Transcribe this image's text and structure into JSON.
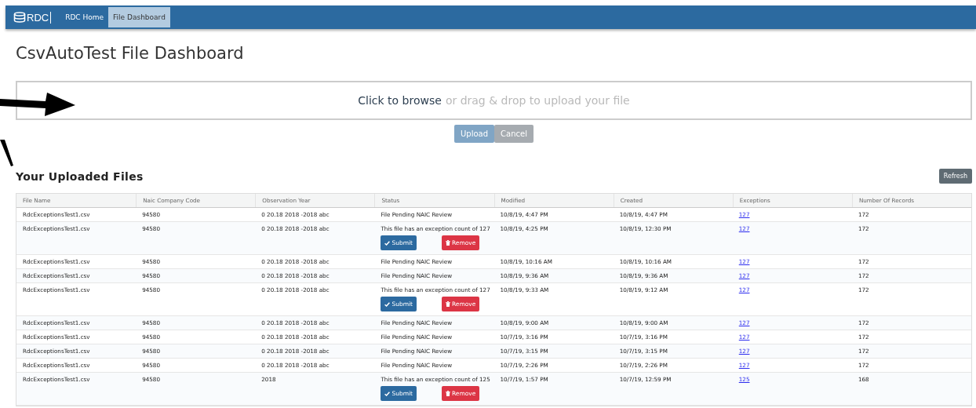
{
  "navbar": {
    "logo": "RDC",
    "items": [
      {
        "label": "RDC Home",
        "selected": false
      },
      {
        "label": "File Dashboard",
        "selected": true
      }
    ]
  },
  "page_title": "CsvAutoTest File Dashboard",
  "dropzone": {
    "link": "Click to browse",
    "hint": "or drag & drop to upload your file"
  },
  "upload_buttons": [
    {
      "label": "Upload",
      "kind": "primary",
      "disabled": true
    },
    {
      "label": "Cancel",
      "kind": "secondary",
      "disabled": true
    }
  ],
  "section_title": "Your Uploaded Files",
  "refresh_button": "Refresh",
  "table": {
    "columns": [
      "File Name",
      "Naic Company Code",
      "Observation Year",
      "Status",
      "Modified",
      "Created",
      "Exceptions",
      "Number Of Records"
    ],
    "rows": [
      {
        "file": "RdcExceptionsTest1.csv",
        "naic": "94580",
        "year": "0 20.18 2018 -2018 abc",
        "status": "File Pending NAIC Review",
        "modified": "10/8/19, 4:47 PM",
        "created": "10/8/19, 4:47 PM",
        "exceptions": "127",
        "records": "172"
      },
      {
        "file": "RdcExceptionsTest1.csv",
        "naic": "94580",
        "year": "0 20.18 2018 -2018 abc",
        "status": "This file has an exception count of 127",
        "actions": [
          {
            "label": "Submit",
            "kind": "submit"
          },
          {
            "label": "Remove",
            "kind": "remove"
          }
        ],
        "modified": "10/8/19, 4:25 PM",
        "created": "10/8/19, 12:30 PM",
        "exceptions": "127",
        "records": "172"
      },
      {
        "file": "RdcExceptionsTest1.csv",
        "naic": "94580",
        "year": "0 20.18 2018 -2018 abc",
        "status": "File Pending NAIC Review",
        "modified": "10/8/19, 10:16 AM",
        "created": "10/8/19, 10:16 AM",
        "exceptions": "127",
        "records": "172"
      },
      {
        "file": "RdcExceptionsTest1.csv",
        "naic": "94580",
        "year": "0 20.18 2018 -2018 abc",
        "status": "File Pending NAIC Review",
        "modified": "10/8/19, 9:36 AM",
        "created": "10/8/19, 9:36 AM",
        "exceptions": "127",
        "records": "172"
      },
      {
        "file": "RdcExceptionsTest1.csv",
        "naic": "94580",
        "year": "0 20.18 2018 -2018 abc",
        "status": "This file has an exception count of 127",
        "actions": [
          {
            "label": "Submit",
            "kind": "submit"
          },
          {
            "label": "Remove",
            "kind": "remove"
          }
        ],
        "modified": "10/8/19, 9:33 AM",
        "created": "10/8/19, 9:12 AM",
        "exceptions": "127",
        "records": "172"
      },
      {
        "file": "RdcExceptionsTest1.csv",
        "naic": "94580",
        "year": "0 20.18 2018 -2018 abc",
        "status": "File Pending NAIC Review",
        "modified": "10/8/19, 9:00 AM",
        "created": "10/8/19, 9:00 AM",
        "exceptions": "127",
        "records": "172"
      },
      {
        "file": "RdcExceptionsTest1.csv",
        "naic": "94580",
        "year": "0 20.18 2018 -2018 abc",
        "status": "File Pending NAIC Review",
        "modified": "10/7/19, 3:16 PM",
        "created": "10/7/19, 3:16 PM",
        "exceptions": "127",
        "records": "172"
      },
      {
        "file": "RdcExceptionsTest1.csv",
        "naic": "94580",
        "year": "0 20.18 2018 -2018 abc",
        "status": "File Pending NAIC Review",
        "modified": "10/7/19, 3:15 PM",
        "created": "10/7/19, 3:15 PM",
        "exceptions": "127",
        "records": "172"
      },
      {
        "file": "RdcExceptionsTest1.csv",
        "naic": "94580",
        "year": "0 20.18 2018 -2018 abc",
        "status": "File Pending NAIC Review",
        "modified": "10/7/19, 2:26 PM",
        "created": "10/7/19, 2:26 PM",
        "exceptions": "127",
        "records": "172"
      },
      {
        "file": "RdcExceptionsTest1.csv",
        "naic": "94580",
        "year": "2018",
        "status": "This file has an exception count of 125",
        "actions": [
          {
            "label": "Submit",
            "kind": "submit"
          },
          {
            "label": "Remove",
            "kind": "remove"
          }
        ],
        "modified": "10/7/19, 1:57 PM",
        "created": "10/7/19, 12:59 PM",
        "exceptions": "125",
        "records": "168"
      }
    ]
  }
}
